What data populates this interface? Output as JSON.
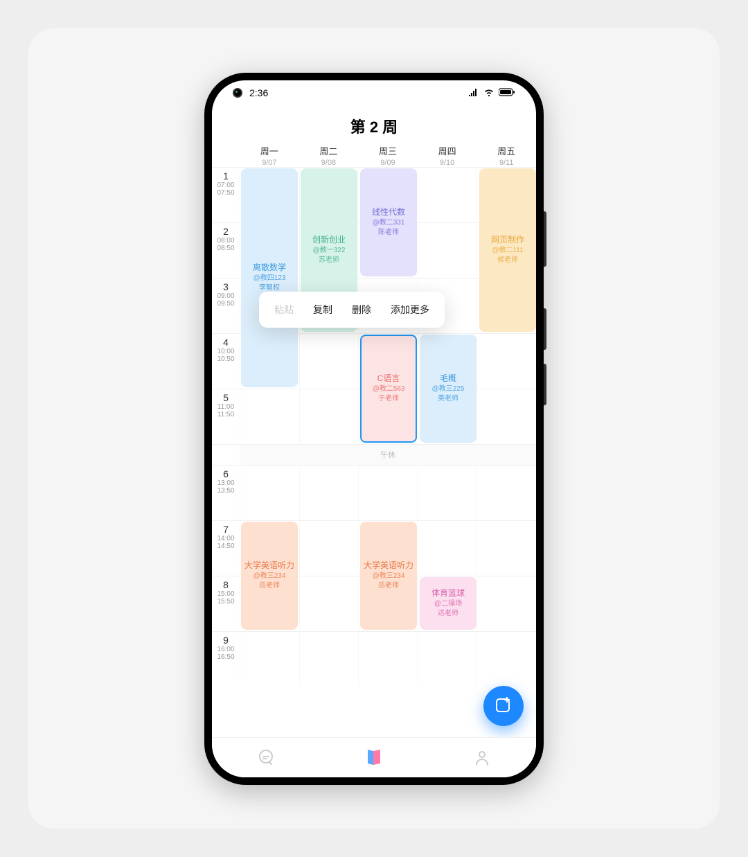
{
  "status": {
    "time": "2:36"
  },
  "title": "第 2 周",
  "days": [
    {
      "label": "周一",
      "date": "9/07"
    },
    {
      "label": "周二",
      "date": "9/08"
    },
    {
      "label": "周三",
      "date": "9/09"
    },
    {
      "label": "周四",
      "date": "9/10"
    },
    {
      "label": "周五",
      "date": "9/11"
    }
  ],
  "slots": [
    {
      "num": "1",
      "start": "07:00",
      "end": "07:50"
    },
    {
      "num": "2",
      "start": "08:00",
      "end": "08:50"
    },
    {
      "num": "3",
      "start": "09:00",
      "end": "09:50"
    },
    {
      "num": "4",
      "start": "10:00",
      "end": "10:50"
    },
    {
      "num": "5",
      "start": "11:00",
      "end": "11:50"
    }
  ],
  "break_label": "午休",
  "slots_pm": [
    {
      "num": "6",
      "start": "13:00",
      "end": "13:50"
    },
    {
      "num": "7",
      "start": "14:00",
      "end": "14:50"
    },
    {
      "num": "8",
      "start": "15:00",
      "end": "15:50"
    },
    {
      "num": "9",
      "start": "16:00",
      "end": "16:50"
    }
  ],
  "cards": {
    "discrete": {
      "name": "离散数学",
      "loc": "@教四123",
      "tch": "李智权"
    },
    "innovate": {
      "name": "创新创业",
      "loc": "@教一322",
      "tch": "苏老师"
    },
    "linear": {
      "name": "线性代数",
      "loc": "@教二331",
      "tch": "陈老师"
    },
    "web": {
      "name": "网页制作",
      "loc": "@教二111",
      "tch": "候老师"
    },
    "clang": {
      "name": "C语言",
      "loc": "@教二563",
      "tch": "于老师"
    },
    "maogai": {
      "name": "毛概",
      "loc": "@教三225",
      "tch": "英老师"
    },
    "eng1": {
      "name": "大学英语听力",
      "loc": "@教三234",
      "tch": "岳老师"
    },
    "eng2": {
      "name": "大学英语听力",
      "loc": "@教三234",
      "tch": "岳老师"
    },
    "pe": {
      "name": "体育篮球",
      "loc": "@二操场",
      "tch": "达老师"
    }
  },
  "context": {
    "paste": "粘贴",
    "copy": "复制",
    "delete": "删除",
    "more": "添加更多"
  }
}
